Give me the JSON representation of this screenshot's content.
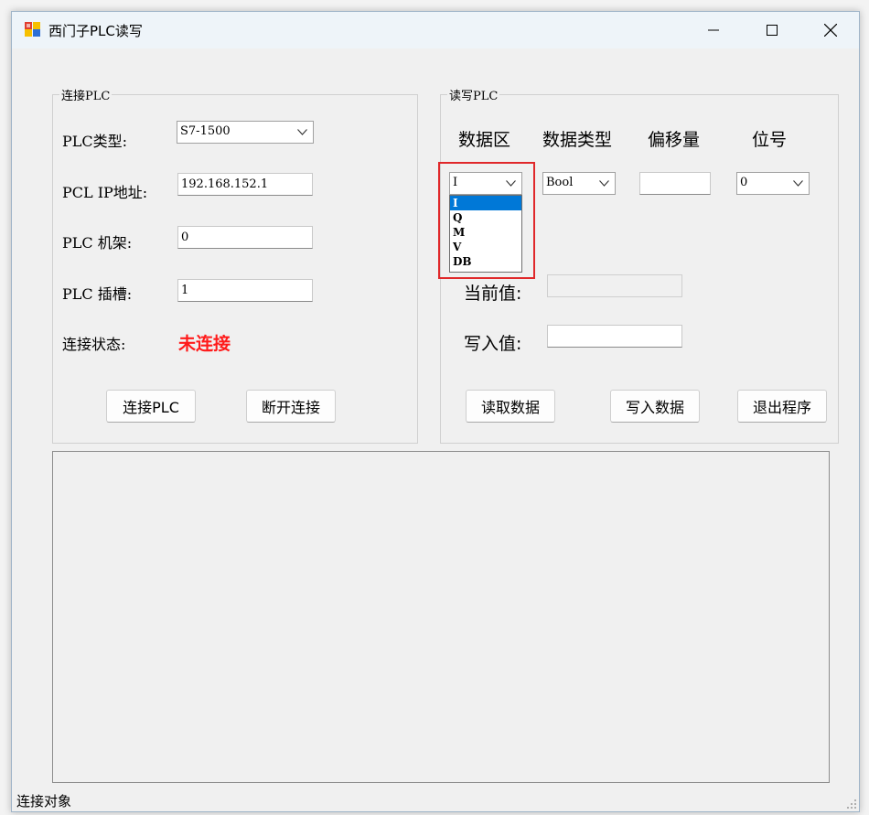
{
  "window": {
    "title": "西门子PLC读写",
    "controls": [
      "minimize",
      "maximize",
      "close"
    ]
  },
  "connection_group": {
    "title": "连接PLC",
    "plc_type_label": "PLC类型:",
    "plc_type_value": "S7-1500",
    "ip_label": "PCL IP地址:",
    "ip_value": "192.168.152.1",
    "rack_label": "PLC 机架:",
    "rack_value": "0",
    "slot_label": "PLC 插槽:",
    "slot_value": "1",
    "status_label": "连接状态:",
    "status_value": "未连接",
    "status_color": "#ff1a1a",
    "connect_button": "连接PLC",
    "disconnect_button": "断开连接"
  },
  "rw_group": {
    "title": "读写PLC",
    "headers": {
      "data_area": "数据区",
      "data_type": "数据类型",
      "offset": "偏移量",
      "bit": "位号"
    },
    "data_area_value": "I",
    "data_area_options": [
      "I",
      "Q",
      "M",
      "V",
      "DB"
    ],
    "data_area_selected": "I",
    "data_type_value": "Bool",
    "offset_value": "",
    "bit_value": "0",
    "current_value_label": "当前值:",
    "current_value": "",
    "write_value_label": "写入值:",
    "write_value": "",
    "read_button": "读取数据",
    "write_button": "写入数据",
    "exit_button": "退出程序"
  },
  "statusbar": {
    "text": "连接对象"
  },
  "colors": {
    "selection": "#0078d7",
    "highlight_box": "#e0282a"
  }
}
